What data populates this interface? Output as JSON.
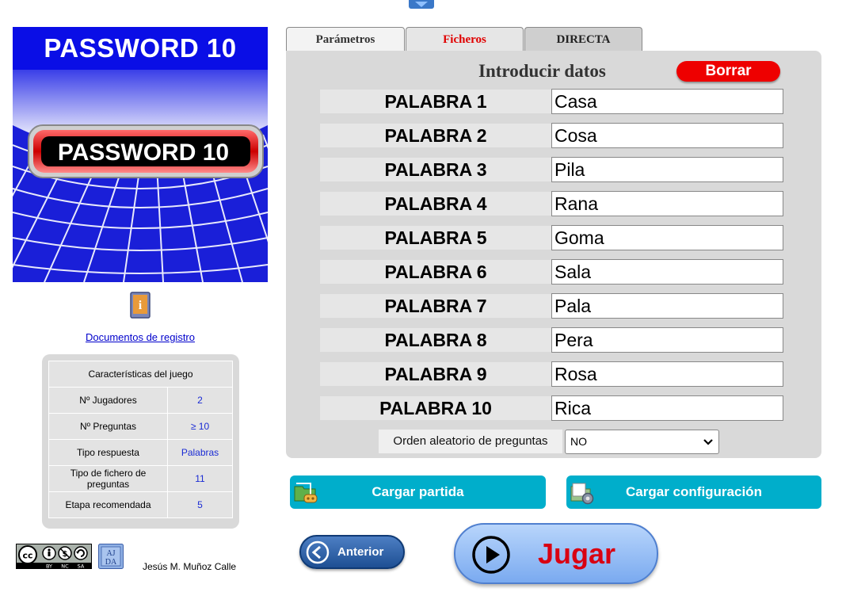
{
  "header": {
    "scroll_icon": "chevron-down-icon"
  },
  "cover": {
    "title": "PASSWORD 10",
    "badge_text": "PASSWORD 10",
    "colors": {
      "title_bar": "#0a0ee6",
      "grid": "#1a1fd8"
    }
  },
  "sidebar": {
    "info_icon": "info-book-icon",
    "doc_link": "Documentos de registro",
    "features": {
      "title": "Características del juego",
      "rows": [
        {
          "label": "Nº Jugadores",
          "value": "2"
        },
        {
          "label": "Nº Preguntas",
          "value": "≥ 10"
        },
        {
          "label": "Tipo respuesta",
          "value": "Palabras"
        },
        {
          "label": "Tipo de fichero de preguntas",
          "value": "11"
        },
        {
          "label": "Etapa recomendada",
          "value": "5"
        }
      ]
    },
    "license_icon": "cc-by-nc-sa-icon",
    "ajda_label": "AJDA",
    "author": "Jesús M. Muñoz Calle"
  },
  "tabs": [
    {
      "label": "Parámetros"
    },
    {
      "label": "Ficheros"
    },
    {
      "label": "DIRECTA"
    }
  ],
  "panel": {
    "title": "Introducir datos",
    "clear_label": "Borrar",
    "words": [
      {
        "label": "PALABRA 1",
        "value": "Casa"
      },
      {
        "label": "PALABRA 2",
        "value": "Cosa"
      },
      {
        "label": "PALABRA 3",
        "value": "Pila"
      },
      {
        "label": "PALABRA 4",
        "value": "Rana"
      },
      {
        "label": "PALABRA 5",
        "value": "Goma"
      },
      {
        "label": "PALABRA 6",
        "value": "Sala"
      },
      {
        "label": "PALABRA 7",
        "value": "Pala"
      },
      {
        "label": "PALABRA 8",
        "value": "Pera"
      },
      {
        "label": "PALABRA 9",
        "value": "Rosa"
      },
      {
        "label": "PALABRA 10",
        "value": "Rica"
      }
    ],
    "order_label": "Orden aleatorio de preguntas",
    "order_value": "NO"
  },
  "actions": {
    "load_game": "Cargar partida",
    "load_config": "Cargar configuración",
    "previous": "Anterior",
    "play": "Jugar",
    "colors": {
      "teal": "#00aecb",
      "clear": "#ee0000",
      "play_text": "#d90012"
    }
  }
}
